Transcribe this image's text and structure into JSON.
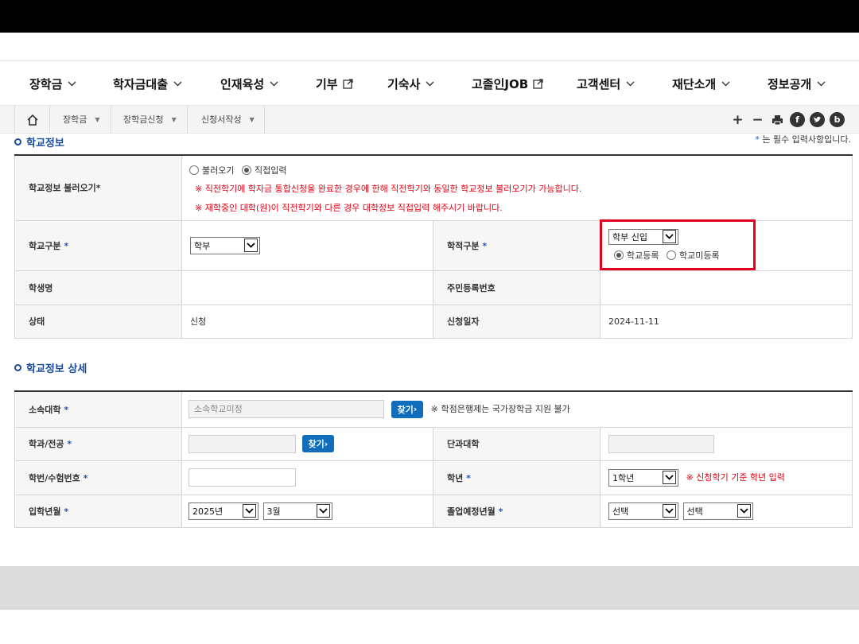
{
  "nav": {
    "items": [
      "장학금",
      "학자금대출",
      "인재육성",
      "기부",
      "기숙사",
      "고졸인JOB",
      "고객센터",
      "재단소개",
      "정보공개"
    ]
  },
  "breadcrumb": {
    "items": [
      "장학금",
      "장학금신청",
      "신청서작성"
    ]
  },
  "section1": {
    "title": "학교정보",
    "required_star": "*",
    "required_note": " 는 필수 입력사항입니다.",
    "load_label": "학교정보 불러오기*",
    "load_opt1": "불러오기",
    "load_opt2": "직접입력",
    "load_note1": "※ 직전학기에 학자금 통합신청을 완료한 경우에 한해 직전학기와 동일한 학교정보 불러오기가 가능합니다.",
    "load_note2": "※ 재학중인 대학(원)이 직전학기와 다른 경우 대학정보 직접입력 해주시기 바랍니다.",
    "school_type_label": "학교구분",
    "school_type_value": "학부",
    "enroll_type_label": "학적구분",
    "enroll_type_value": "학부 신입",
    "enroll_opt1": "학교등록",
    "enroll_opt2": "학교미등록",
    "student_name_label": "학생명",
    "resident_no_label": "주민등록번호",
    "status_label": "상태",
    "status_value": "신청",
    "apply_date_label": "신청일자",
    "apply_date_value": "2024-11-11"
  },
  "section2": {
    "title": "학교정보 상세",
    "univ_label": "소속대학",
    "univ_placeholder": "소속학교미정",
    "find_btn": "찾기",
    "univ_note": "※ 학점은행제는 국가장학금 지원 불가",
    "major_label": "학과/전공",
    "college_label": "단과대학",
    "student_no_label": "학번/수험번호",
    "grade_label": "학년",
    "grade_value": "1학년",
    "grade_note": "※ 신청학기 기준 학년 입력",
    "admission_label": "입학년월",
    "admission_year": "2025년",
    "admission_month": "3월",
    "graduation_label": "졸업예정년월",
    "grad_year": "선택",
    "grad_month": "선택"
  }
}
